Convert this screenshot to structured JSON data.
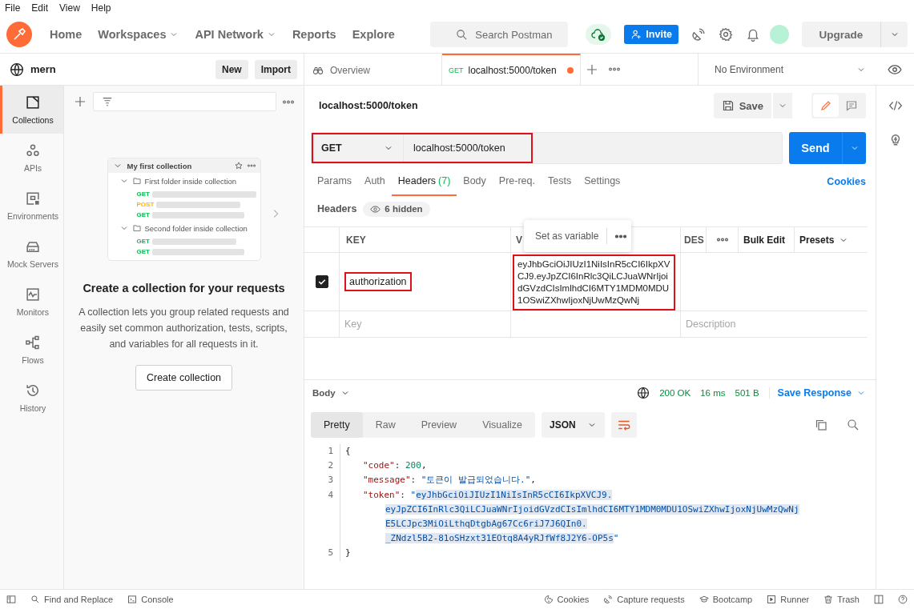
{
  "menu": [
    "File",
    "Edit",
    "View",
    "Help"
  ],
  "nav": [
    {
      "label": "Home",
      "dropdown": false
    },
    {
      "label": "Workspaces",
      "dropdown": true
    },
    {
      "label": "API Network",
      "dropdown": true
    },
    {
      "label": "Reports",
      "dropdown": false
    },
    {
      "label": "Explore",
      "dropdown": false
    }
  ],
  "search": {
    "placeholder": "Search Postman"
  },
  "invite": "Invite",
  "upgrade": "Upgrade",
  "workspace": {
    "name": "mern",
    "buttons": [
      "New",
      "Import"
    ]
  },
  "sidebar": {
    "items": [
      {
        "label": "Collections",
        "selected": true
      },
      {
        "label": "APIs",
        "selected": false
      },
      {
        "label": "Environments",
        "selected": false
      },
      {
        "label": "Mock Servers",
        "selected": false
      },
      {
        "label": "Monitors",
        "selected": false
      },
      {
        "label": "Flows",
        "selected": false
      },
      {
        "label": "History",
        "selected": false
      }
    ]
  },
  "preview": {
    "collection": "My first collection",
    "folders": [
      {
        "name": "First folder inside collection",
        "requests": [
          {
            "method": "GET",
            "color": "#0cbb52"
          },
          {
            "method": "POST",
            "color": "#ffb400"
          },
          {
            "method": "GET",
            "color": "#0cbb52"
          }
        ]
      },
      {
        "name": "Second folder inside collection",
        "requests": [
          {
            "method": "GET",
            "color": "#0cbb52"
          },
          {
            "method": "GET",
            "color": "#0cbb52"
          }
        ]
      }
    ]
  },
  "empty": {
    "title": "Create a collection for your requests",
    "text": "A collection lets you group related requests and easily set common authorization, tests, scripts, and variables for all requests in it.",
    "button": "Create collection"
  },
  "tabs": [
    {
      "kind": "overview",
      "label": "Overview",
      "selected": false,
      "unsaved": false
    },
    {
      "kind": "request",
      "method": "GET",
      "label": "localhost:5000/token",
      "selected": true,
      "unsaved": true
    }
  ],
  "environment": "No Environment",
  "request": {
    "title": "localhost:5000/token",
    "save": "Save",
    "method": "GET",
    "url": "localhost:5000/token",
    "highlighted": true,
    "send": "Send"
  },
  "request_tabs": [
    {
      "label": "Params",
      "selected": false
    },
    {
      "label": "Auth",
      "selected": false
    },
    {
      "label": "Headers",
      "count": "(7)",
      "selected": true
    },
    {
      "label": "Body",
      "selected": false
    },
    {
      "label": "Pre-req.",
      "selected": false
    },
    {
      "label": "Tests",
      "selected": false
    },
    {
      "label": "Settings",
      "selected": false
    }
  ],
  "cookies_link": "Cookies",
  "headers": {
    "label": "Headers",
    "hidden": "6 hidden",
    "columns": [
      "KEY",
      "V",
      "DES"
    ],
    "tooltip": "Set as variable",
    "bulk_edit": "Bulk Edit",
    "presets": "Presets",
    "rows": [
      {
        "checked": true,
        "key": "authorization",
        "value": "eyJhbGciOiJIUzI1NiIsInR5cCI6IkpXVCJ9.eyJpZCI6InRlc3QiLCJuaWNrIjoidGVzdCIsImlhdCI6MTY1MDM0MDU1OSwiZXhwIjoxNjUwMzQwNj",
        "key_highlighted": true,
        "value_highlighted": true
      }
    ],
    "new_row": {
      "key_placeholder": "Key",
      "description_placeholder": "Description"
    }
  },
  "response": {
    "label": "Body",
    "status": "200 OK",
    "time": "16 ms",
    "size": "501 B",
    "save": "Save Response",
    "views": [
      {
        "label": "Pretty",
        "selected": true
      },
      {
        "label": "Raw",
        "selected": false
      },
      {
        "label": "Preview",
        "selected": false
      },
      {
        "label": "Visualize",
        "selected": false
      }
    ],
    "format": "JSON",
    "lines": [
      {
        "kind": "top",
        "number": "1",
        "segments": [
          {
            "kind": "punct",
            "text": "{"
          }
        ]
      },
      {
        "kind": "inner",
        "number": "2",
        "segments": [
          {
            "kind": "key",
            "text": "\"code\""
          },
          {
            "kind": "punct",
            "text": ": "
          },
          {
            "kind": "number",
            "text": "200"
          },
          {
            "kind": "punct",
            "text": ","
          }
        ]
      },
      {
        "kind": "inner",
        "number": "3",
        "segments": [
          {
            "kind": "key",
            "text": "\"message\""
          },
          {
            "kind": "punct",
            "text": ": "
          },
          {
            "kind": "string",
            "text": "\"토큰이 발급되었습니다.\""
          },
          {
            "kind": "punct",
            "text": ","
          }
        ]
      },
      {
        "kind": "inner",
        "number": "4",
        "segments": [
          {
            "kind": "key",
            "text": "\"token\""
          },
          {
            "kind": "punct",
            "text": ": "
          },
          {
            "kind": "string",
            "text": "\""
          },
          {
            "kind": "selected",
            "text": "eyJhbGciOiJIUzI1NiIsInR5cCI6IkpXVCJ9."
          }
        ]
      },
      {
        "kind": "wrap",
        "segments": [
          {
            "kind": "selected",
            "text": "eyJpZCI6InRlc3QiLCJuaWNrIjoidGVzdCIsImlhdCI6MTY1MDM0MDU1OSwiZXhwIjoxNjUwMzQwNj"
          }
        ]
      },
      {
        "kind": "wrap",
        "segments": [
          {
            "kind": "selected",
            "text": "E5LCJpc3MiOiLthqDtgbAg67Cc6riJ7J6QIn0."
          }
        ]
      },
      {
        "kind": "wrap",
        "segments": [
          {
            "kind": "selected",
            "text": "_ZNdzl5B2-81oSHzxt31EOtq8A4yRJfWf8J2Y6-OP5s"
          },
          {
            "kind": "string",
            "text": "\""
          }
        ]
      },
      {
        "kind": "top",
        "number": "5",
        "segments": [
          {
            "kind": "punct",
            "text": "}"
          }
        ]
      }
    ]
  },
  "status_bar": {
    "left": [
      "Find and Replace",
      "Console"
    ],
    "right": [
      "Cookies",
      "Capture requests",
      "Bootcamp",
      "Runner",
      "Trash"
    ]
  }
}
